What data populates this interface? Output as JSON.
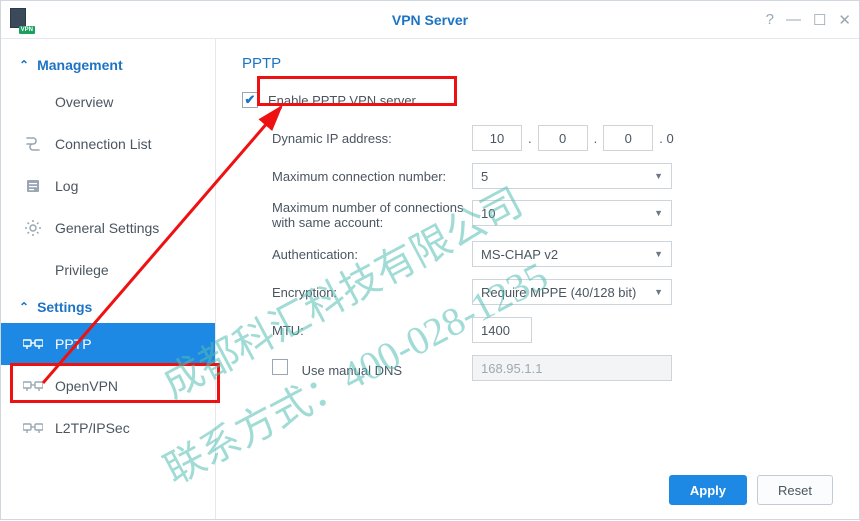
{
  "window": {
    "title": "VPN Server",
    "icon_badge": "VPN"
  },
  "sidebar": {
    "sections": [
      {
        "label": "Management",
        "items": [
          {
            "label": "Overview",
            "icon": "overview-icon"
          },
          {
            "label": "Connection List",
            "icon": "connection-list-icon"
          },
          {
            "label": "Log",
            "icon": "log-icon"
          },
          {
            "label": "General Settings",
            "icon": "gear-icon"
          },
          {
            "label": "Privilege",
            "icon": "privilege-icon"
          }
        ]
      },
      {
        "label": "Settings",
        "items": [
          {
            "label": "PPTP",
            "icon": "pptp-icon",
            "active": true
          },
          {
            "label": "OpenVPN",
            "icon": "openvpn-icon"
          },
          {
            "label": "L2TP/IPSec",
            "icon": "l2tp-icon"
          }
        ]
      }
    ]
  },
  "main": {
    "heading": "PPTP",
    "enable_label": "Enable PPTP VPN server",
    "enable_checked": true,
    "rows": {
      "dynamic_ip_label": "Dynamic IP address:",
      "dynamic_ip": {
        "o1": "10",
        "o2": "0",
        "o3": "0",
        "tail": ". 0"
      },
      "max_conn_label": "Maximum connection number:",
      "max_conn_value": "5",
      "max_conn_same_label_a": "Maximum number of connections",
      "max_conn_same_label_b": "with same account:",
      "max_conn_same_value": "10",
      "auth_label": "Authentication:",
      "auth_value": "MS-CHAP v2",
      "enc_label": "Encryption:",
      "enc_value": "Require MPPE (40/128 bit)",
      "mtu_label": "MTU:",
      "mtu_value": "1400",
      "manual_dns_label": "Use manual DNS",
      "manual_dns_checked": false,
      "manual_dns_value": "168.95.1.1"
    }
  },
  "footer": {
    "apply": "Apply",
    "reset": "Reset"
  },
  "watermark": {
    "line1": "成都科汇科技有限公司",
    "line2": "联系方式：400-028-1235"
  }
}
